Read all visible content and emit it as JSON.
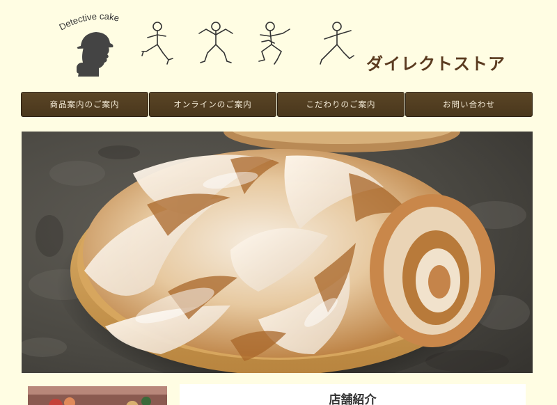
{
  "header": {
    "logo_text": "Detective  cake",
    "store_title": "ダイレクトストア"
  },
  "nav": {
    "items": [
      {
        "label": "商品案内のご案内"
      },
      {
        "label": "オンラインのご案内"
      },
      {
        "label": "こだわりのご案内"
      },
      {
        "label": "お問い合わせ"
      }
    ]
  },
  "content": {
    "section_title": "店舗紹介"
  },
  "colors": {
    "background": "#fffde3",
    "nav_background": "#4f3b1f",
    "nav_text": "#f3ead6",
    "title_color": "#5a3a1f"
  },
  "icons": {
    "logo": "detective-silhouette-icon",
    "figures": [
      "stick-figure-icon",
      "stick-figure-icon",
      "stick-figure-icon",
      "stick-figure-icon"
    ]
  }
}
